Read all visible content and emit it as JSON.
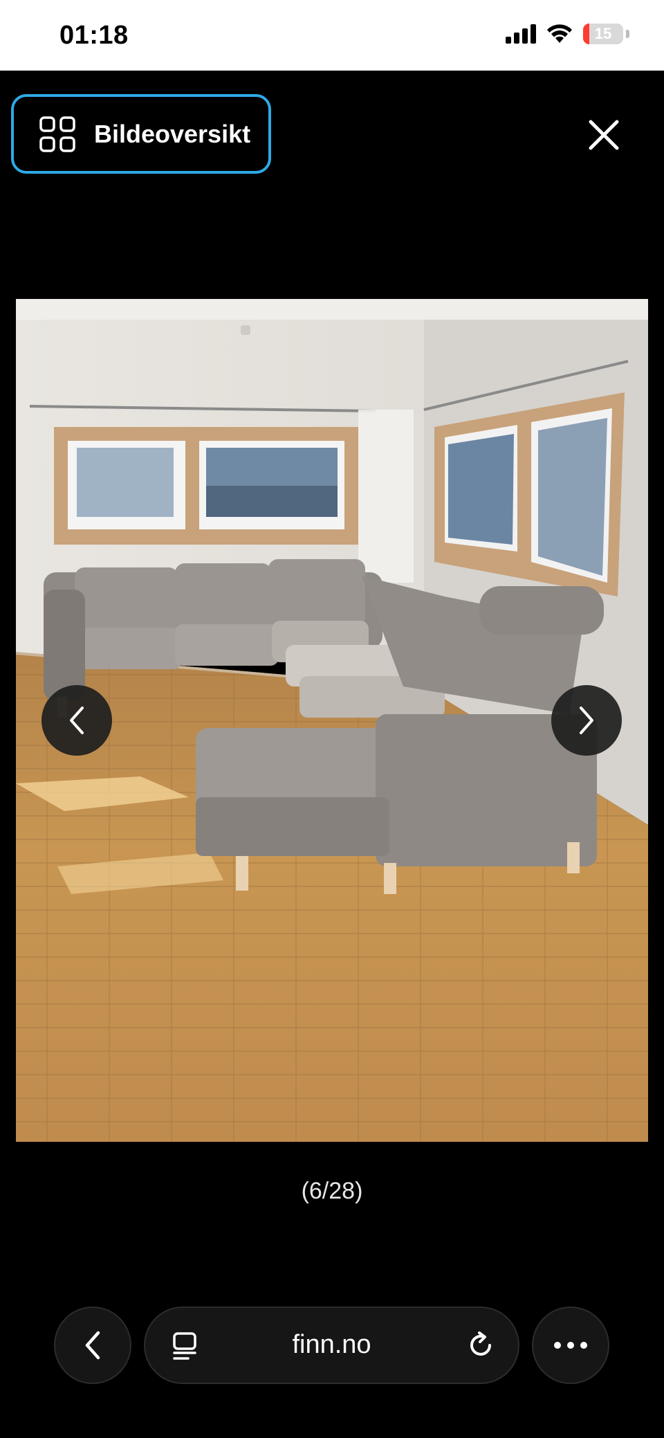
{
  "status_bar": {
    "time": "01:18",
    "battery_level": "15",
    "battery_fraction": 0.15,
    "icons": [
      "cellular-signal-icon",
      "wifi-icon",
      "battery-icon"
    ]
  },
  "gallery": {
    "overview_label": "Bildeoversikt",
    "counter": "(6/28)",
    "photo_description_icon": "sofa-photo"
  },
  "browser": {
    "url": "finn.no"
  },
  "colors": {
    "overview_border": "#2fa9e6",
    "background": "#000000",
    "battery_low": "#ff3b30"
  }
}
